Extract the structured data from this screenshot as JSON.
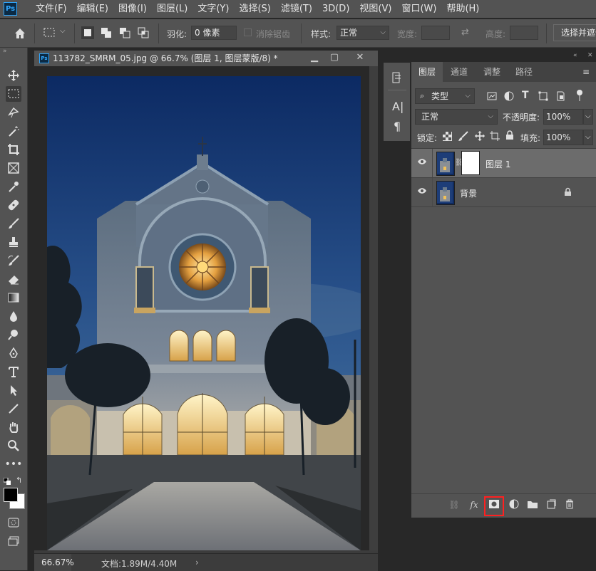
{
  "app": {
    "logo": "Ps"
  },
  "menu": [
    "文件(F)",
    "编辑(E)",
    "图像(I)",
    "图层(L)",
    "文字(Y)",
    "选择(S)",
    "滤镜(T)",
    "3D(D)",
    "视图(V)",
    "窗口(W)",
    "帮助(H)"
  ],
  "options": {
    "feather_label": "羽化:",
    "feather_value": "0 像素",
    "antialias_label": "消除锯齿",
    "style_label": "样式:",
    "style_value": "正常",
    "width_label": "宽度:",
    "height_label": "高度:",
    "select_mask_label": "选择并遮住..."
  },
  "document": {
    "title": "113782_SMRM_05.jpg @ 66.7% (图层 1, 图层蒙版/8) *",
    "zoom": "66.67%",
    "doc_info": "文档:1.89M/4.40M"
  },
  "layers_panel": {
    "tabs": [
      "图层",
      "通道",
      "调整",
      "路径"
    ],
    "active_tab": "图层",
    "filter_kind": "类型",
    "blend_mode": "正常",
    "opacity_label": "不透明度:",
    "opacity_value": "100%",
    "lock_label": "锁定:",
    "fill_label": "填充:",
    "fill_value": "100%",
    "layers": [
      {
        "name": "图层 1",
        "selected": true,
        "has_mask": true,
        "visible": true
      },
      {
        "name": "背景",
        "selected": false,
        "locked": true,
        "visible": true
      }
    ],
    "bottom_icons": [
      "link-icon",
      "fx-icon",
      "add-mask-icon",
      "adjustment-icon",
      "group-folder-icon",
      "new-layer-icon",
      "trash-icon"
    ],
    "highlighted_button": "add-mask-icon",
    "highlight_color": "#ff2020"
  },
  "colors": {
    "accent": "#31a8ff",
    "panel_bg": "#535353",
    "workspace": "#282828"
  }
}
